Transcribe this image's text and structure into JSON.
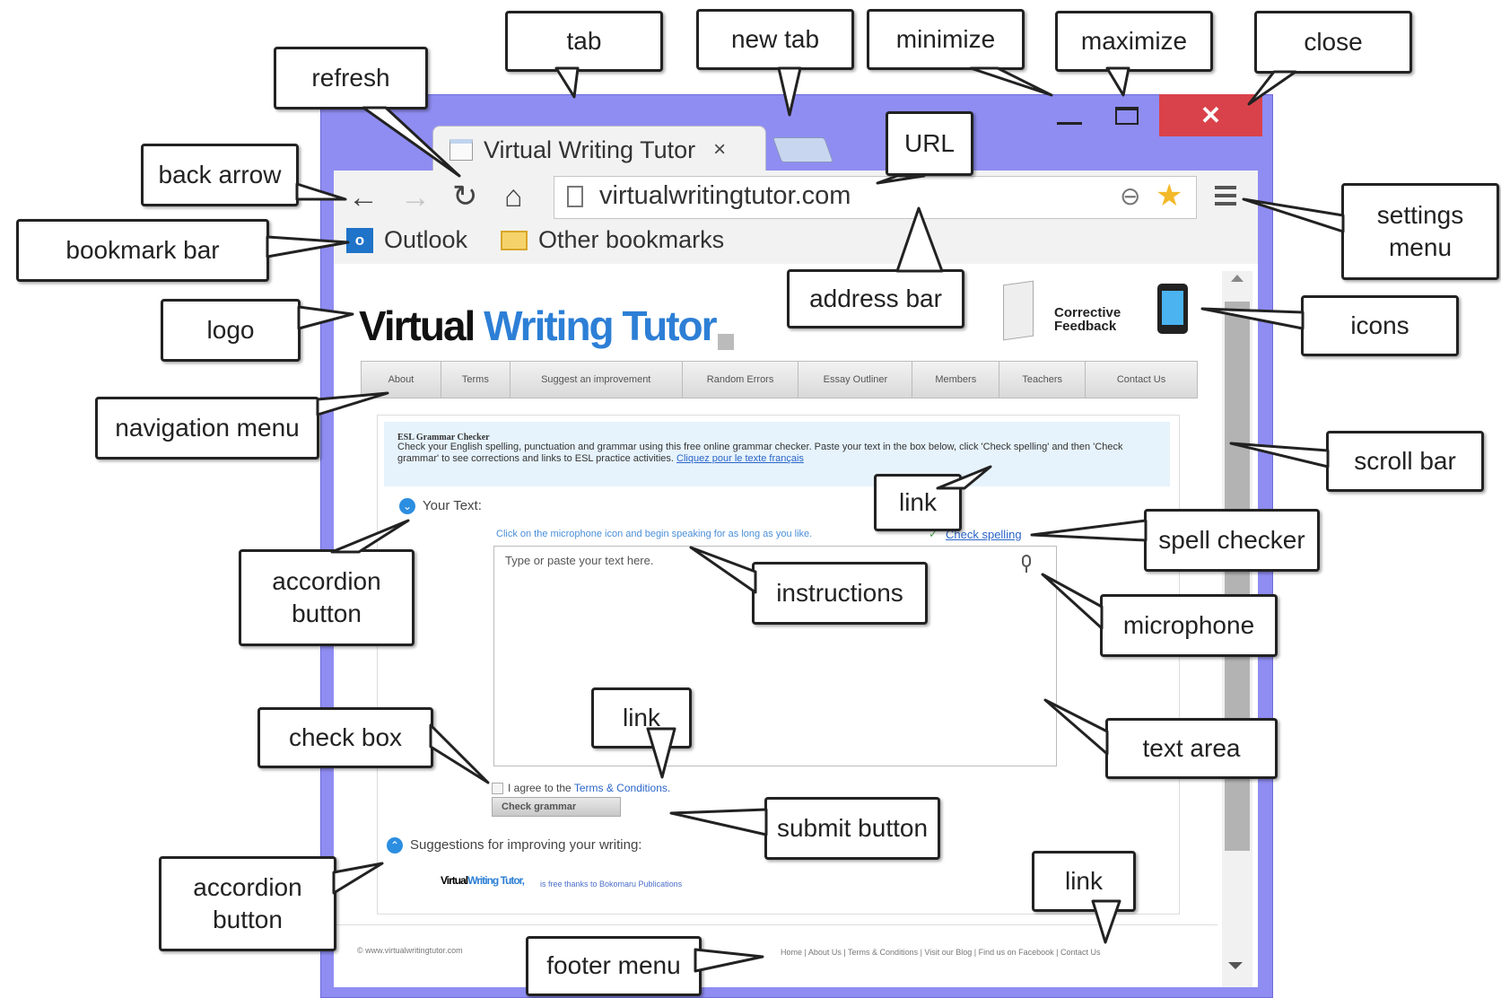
{
  "browser": {
    "tab_title": "Virtual Writing Tutor",
    "tab_close": "×",
    "close_glyph": "✕",
    "url": "virtualwritingtutor.com",
    "bookmarks": [
      "Outlook",
      "Other bookmarks"
    ],
    "nav_glyphs": {
      "back": "←",
      "forward": "→",
      "refresh": "↻",
      "home": "⌂"
    }
  },
  "page": {
    "logo": {
      "part1": "Virtual",
      "part2": "Writing Tutor"
    },
    "corrective_feedback": "Corrective Feedback",
    "nav_items": [
      "About",
      "Terms",
      "Suggest an improvement",
      "Random Errors",
      "Essay Outliner",
      "Members",
      "Teachers",
      "Contact Us"
    ],
    "info_title": "ESL Grammar Checker",
    "info_text": "Check your English spelling, punctuation and grammar using this free online grammar checker. Paste your text in the box below, click 'Check spelling' and then 'Check grammar' to see corrections and links to ESL practice activities.",
    "info_link": "Cliquez pour le texte français",
    "your_text": "Your Text:",
    "instructions": "Click on the microphone icon and begin speaking for as long as you like.",
    "spell_checker": "Check spelling",
    "textarea_placeholder": "Type or paste your text here.",
    "agree_text": "I agree to the",
    "agree_link": "Terms & Conditions.",
    "submit": "Check grammar",
    "suggestions": "Suggestions for improving your writing:",
    "mini_logo": {
      "part1": "Virtual",
      "part2": "Writing Tutor,"
    },
    "mini_thanks": "is free thanks to Bokomaru Publications",
    "footer_left": "© www.virtualwritingtutor.com",
    "footer_right": "Home | About Us | Terms & Conditions | Visit our Blog | Find us on Facebook | Contact Us"
  },
  "callouts": {
    "tab": "tab",
    "new_tab": "new tab",
    "minimize": "minimize",
    "maximize": "maximize",
    "close": "close",
    "refresh": "refresh",
    "url": "URL",
    "back_arrow": "back arrow",
    "settings_menu": "settings menu",
    "bookmark_bar": "bookmark bar",
    "address_bar": "address bar",
    "logo": "logo",
    "icons": "icons",
    "navigation_menu": "navigation menu",
    "scroll_bar": "scroll bar",
    "link_1": "link",
    "spell_checker": "spell checker",
    "accordion_button_1": "accordion button",
    "instructions": "instructions",
    "microphone": "microphone",
    "check_box": "check box",
    "link_2": "link",
    "text_area": "text area",
    "submit_button": "submit button",
    "accordion_button_2": "accordion button",
    "link_3": "link",
    "footer_menu": "footer menu"
  }
}
